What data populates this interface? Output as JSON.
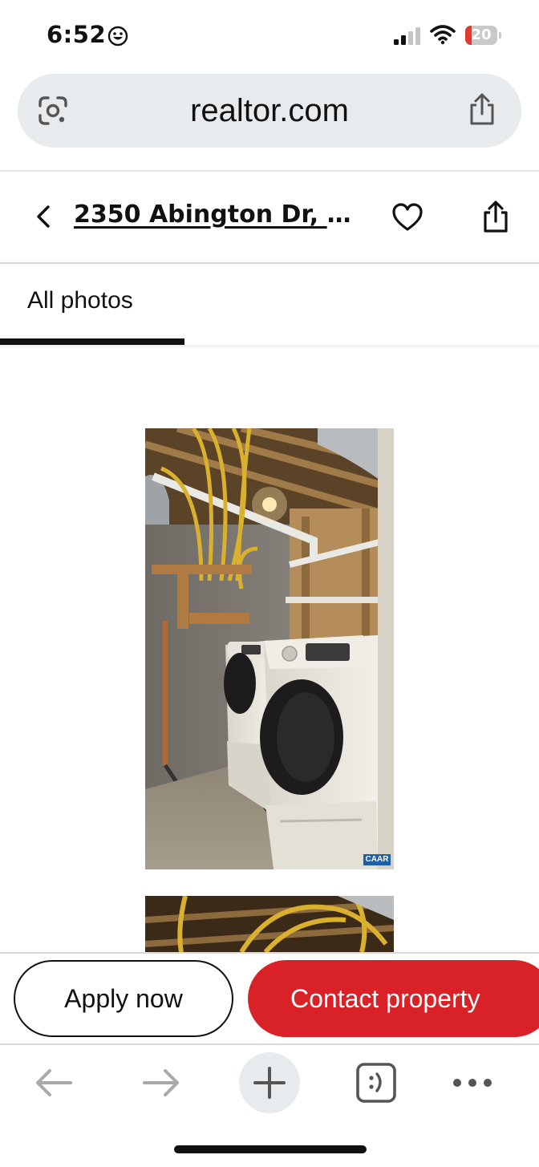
{
  "status_bar": {
    "time": "6:52",
    "battery_level": "20",
    "battery_fraction": 0.2,
    "battery_color": "#e03a2f"
  },
  "browser": {
    "url": "realtor.com"
  },
  "listing": {
    "address": "2350 Abington Dr, C..."
  },
  "tabs": [
    {
      "label": "All photos",
      "active": true
    }
  ],
  "photos": [
    {
      "subject": "laundry room with washer and dryer",
      "watermark": "CAAR"
    },
    {
      "subject": "basement ceiling with gas lines"
    }
  ],
  "actions": {
    "apply_label": "Apply now",
    "contact_label": "Contact property",
    "contact_color": "#d92228"
  },
  "icons": {
    "status": [
      "smiley-icon",
      "cellular-signal-icon",
      "wifi-icon",
      "battery-icon"
    ],
    "url_bar": [
      "google-lens-icon",
      "share-icon"
    ],
    "header": [
      "back-chevron-icon",
      "heart-icon",
      "share-icon"
    ],
    "toolbar": [
      "back-arrow-icon",
      "forward-arrow-icon",
      "plus-icon",
      "tab-switcher-icon",
      "more-dots-icon"
    ]
  }
}
